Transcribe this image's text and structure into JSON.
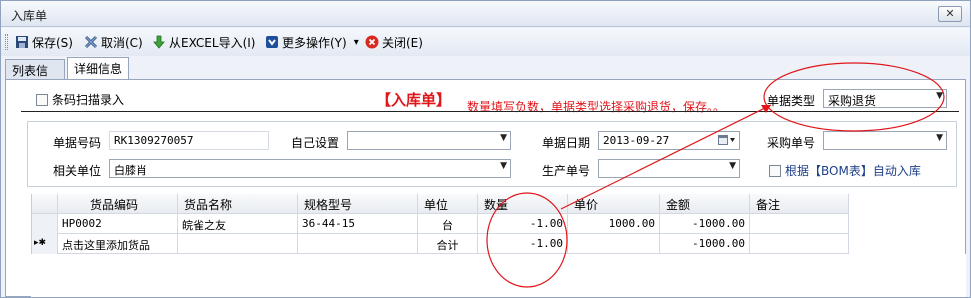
{
  "window": {
    "title": "入库单",
    "close_label": "✕"
  },
  "toolbar": {
    "save": "保存(S)",
    "cancel": "取消(C)",
    "import": "从EXCEL导入(I)",
    "more": "更多操作(Y)",
    "more_arrow": "▾",
    "close": "关闭(E)"
  },
  "tabs": {
    "list": "列表信息",
    "detail": "详细信息"
  },
  "form": {
    "barcode_scan": "条码扫描录入",
    "heading": "【入库单】",
    "note": "数量填写负数，单据类型选择采购退货，保存。。",
    "doc_type_label": "单据类型",
    "doc_type_value": "采购退货",
    "doc_no_label": "单据号码",
    "doc_no_value": "RK1309270057",
    "self_setting_label": "自己设置",
    "self_setting_value": "",
    "doc_date_label": "单据日期",
    "doc_date_value": "2013-09-27",
    "purchase_no_label": "采购单号",
    "purchase_no_value": "",
    "related_unit_label": "相关单位",
    "related_unit_value": "白膝肖",
    "production_no_label": "生产单号",
    "production_no_value": "",
    "bom_auto_label": "根据【BOM表】自动入库"
  },
  "grid": {
    "columns": [
      "货品编码",
      "货品名称",
      "规格型号",
      "单位",
      "数量",
      "单价",
      "金额",
      "备注"
    ],
    "rows": [
      {
        "code": "HP0002",
        "name": "皖雀之友",
        "spec": "36-44-15",
        "unit": "台",
        "qty": "-1.00",
        "price": "1000.00",
        "amount": "-1000.00",
        "remark": ""
      }
    ],
    "add_row_label": "点击这里添加货品",
    "total_label": "合计",
    "total_qty": "-1.00",
    "total_amount": "-1000.00",
    "row_marker": "▸✱"
  }
}
